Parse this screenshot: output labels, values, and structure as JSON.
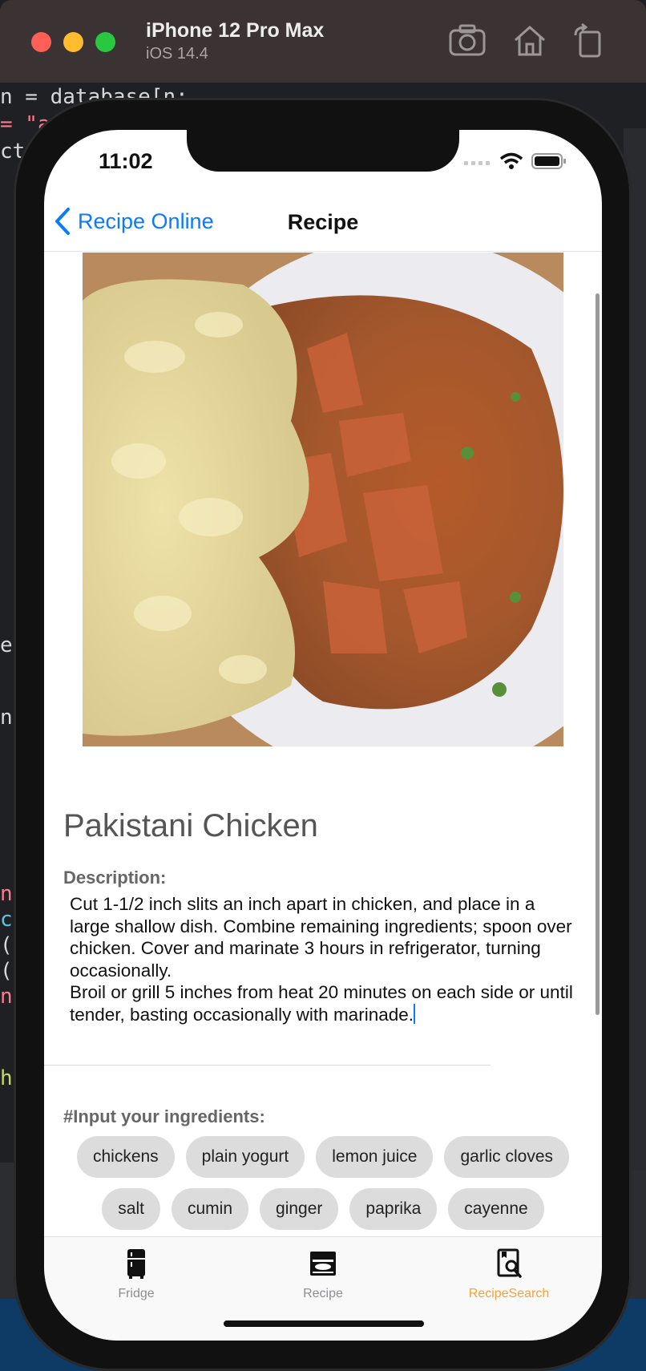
{
  "simulator": {
    "device_name": "iPhone 12 Pro Max",
    "os_version": "iOS 14.4"
  },
  "status_bar": {
    "time": "11:02"
  },
  "nav": {
    "back_label": "Recipe Online",
    "title": "Recipe"
  },
  "recipe": {
    "title": "Pakistani Chicken",
    "description_label": "Description:",
    "description": "Cut 1-1/2 inch slits an inch apart in chicken, and place in a\nlarge shallow dish. Combine remaining ingredients; spoon over\nchicken. Cover and marinate 3 hours in refrigerator, turning\noccasionally.\nBroil or grill 5 inches from heat 20 minutes on each side or until\ntender, basting occasionally with marinade.",
    "ingredients_label": "#Input your ingredients:",
    "ingredients_row1": [
      "chickens",
      "plain yogurt",
      "lemon juice",
      "garlic cloves"
    ],
    "ingredients_row2": [
      "salt",
      "cumin",
      "ginger",
      "paprika",
      "cayenne"
    ]
  },
  "tabbar": {
    "tabs": [
      {
        "label": "Fridge",
        "icon": "fridge-icon",
        "active": false
      },
      {
        "label": "Recipe",
        "icon": "recipe-book-icon",
        "active": false
      },
      {
        "label": "RecipeSearch",
        "icon": "recipe-search-icon",
        "active": true
      }
    ]
  },
  "colors": {
    "accent": "#0a7aff",
    "active_tab": "#f5a33a",
    "chip_bg": "#dcdcdc"
  }
}
